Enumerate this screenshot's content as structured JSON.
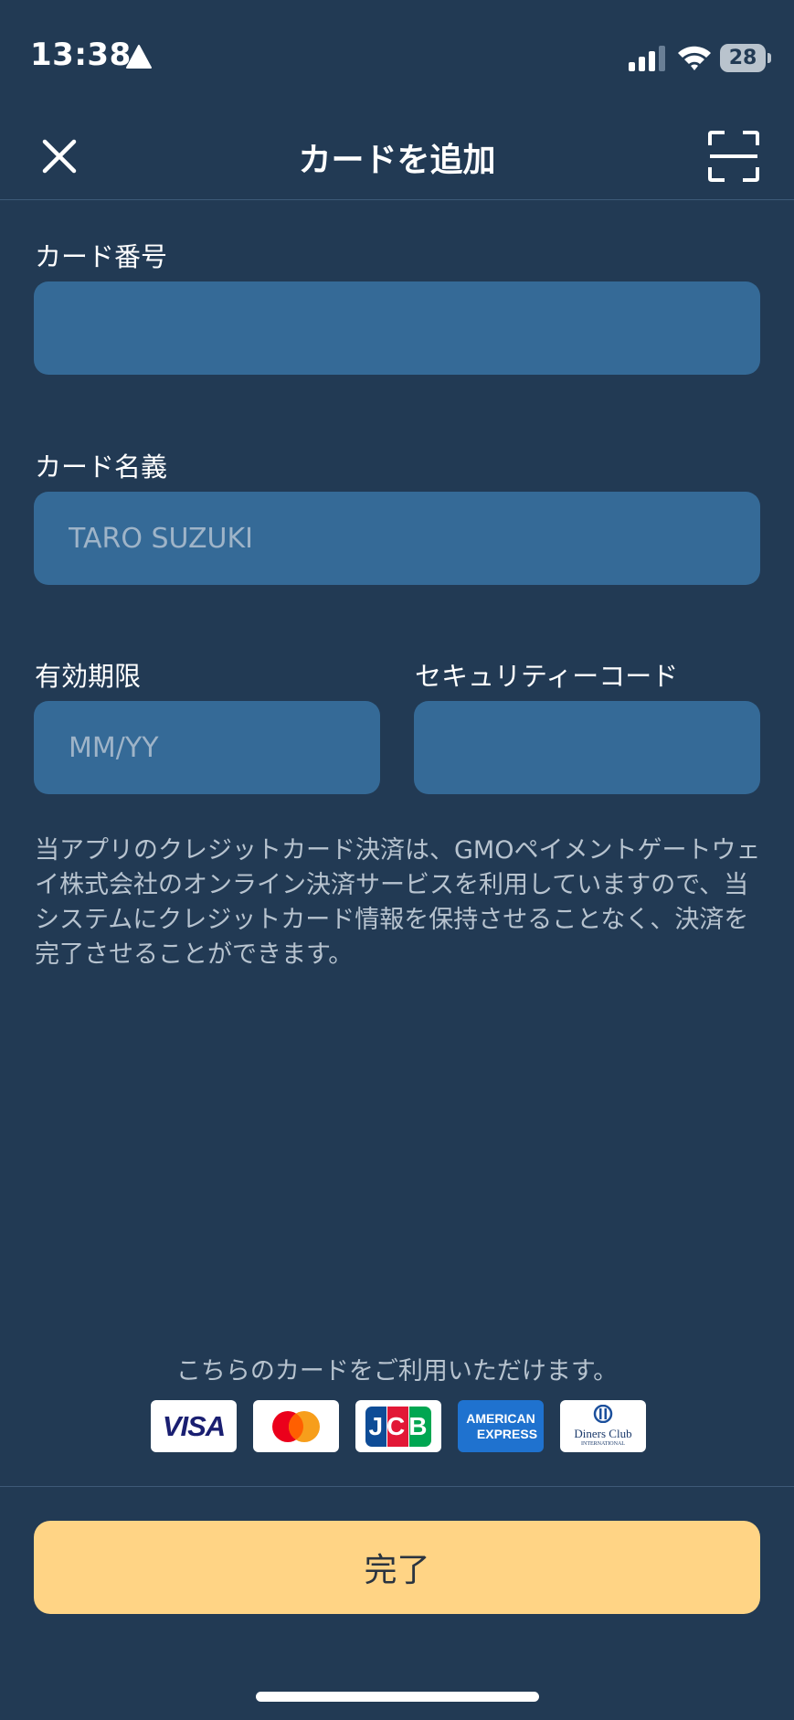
{
  "status_bar": {
    "time": "13:38",
    "battery": "28"
  },
  "nav": {
    "title": "カードを追加"
  },
  "form": {
    "card_number": {
      "label": "カード番号",
      "value": "",
      "placeholder": ""
    },
    "card_holder": {
      "label": "カード名義",
      "value": "",
      "placeholder": "TARO SUZUKI"
    },
    "expiry": {
      "label": "有効期限",
      "value": "",
      "placeholder": "MM/YY"
    },
    "security_code": {
      "label": "セキュリティーコード",
      "value": "",
      "placeholder": ""
    }
  },
  "notice": "当アプリのクレジットカード決済は、GMOペイメントゲートウェイ株式会社のオンライン決済サービスを利用していますので、当システムにクレジットカード情報を保持させることなく、決済を完了させることができます。",
  "accepted_cards": {
    "caption": "こちらのカードをご利用いただけます。",
    "brands": [
      {
        "name": "visa-logo",
        "text": "VISA"
      },
      {
        "name": "mastercard-logo",
        "text": ""
      },
      {
        "name": "jcb-logo",
        "text": "JCB"
      },
      {
        "name": "amex-logo",
        "text_line1": "AMERICAN",
        "text_line2": "EXPRESS"
      },
      {
        "name": "diners-club-logo",
        "text_line1": "Diners Club",
        "text_line2": "INTERNATIONAL"
      }
    ]
  },
  "footer": {
    "done_label": "完了"
  },
  "colors": {
    "background": "#223a54",
    "input_background": "#356a97",
    "primary_button": "#ffd485",
    "muted_text": "#b7c3cf"
  }
}
